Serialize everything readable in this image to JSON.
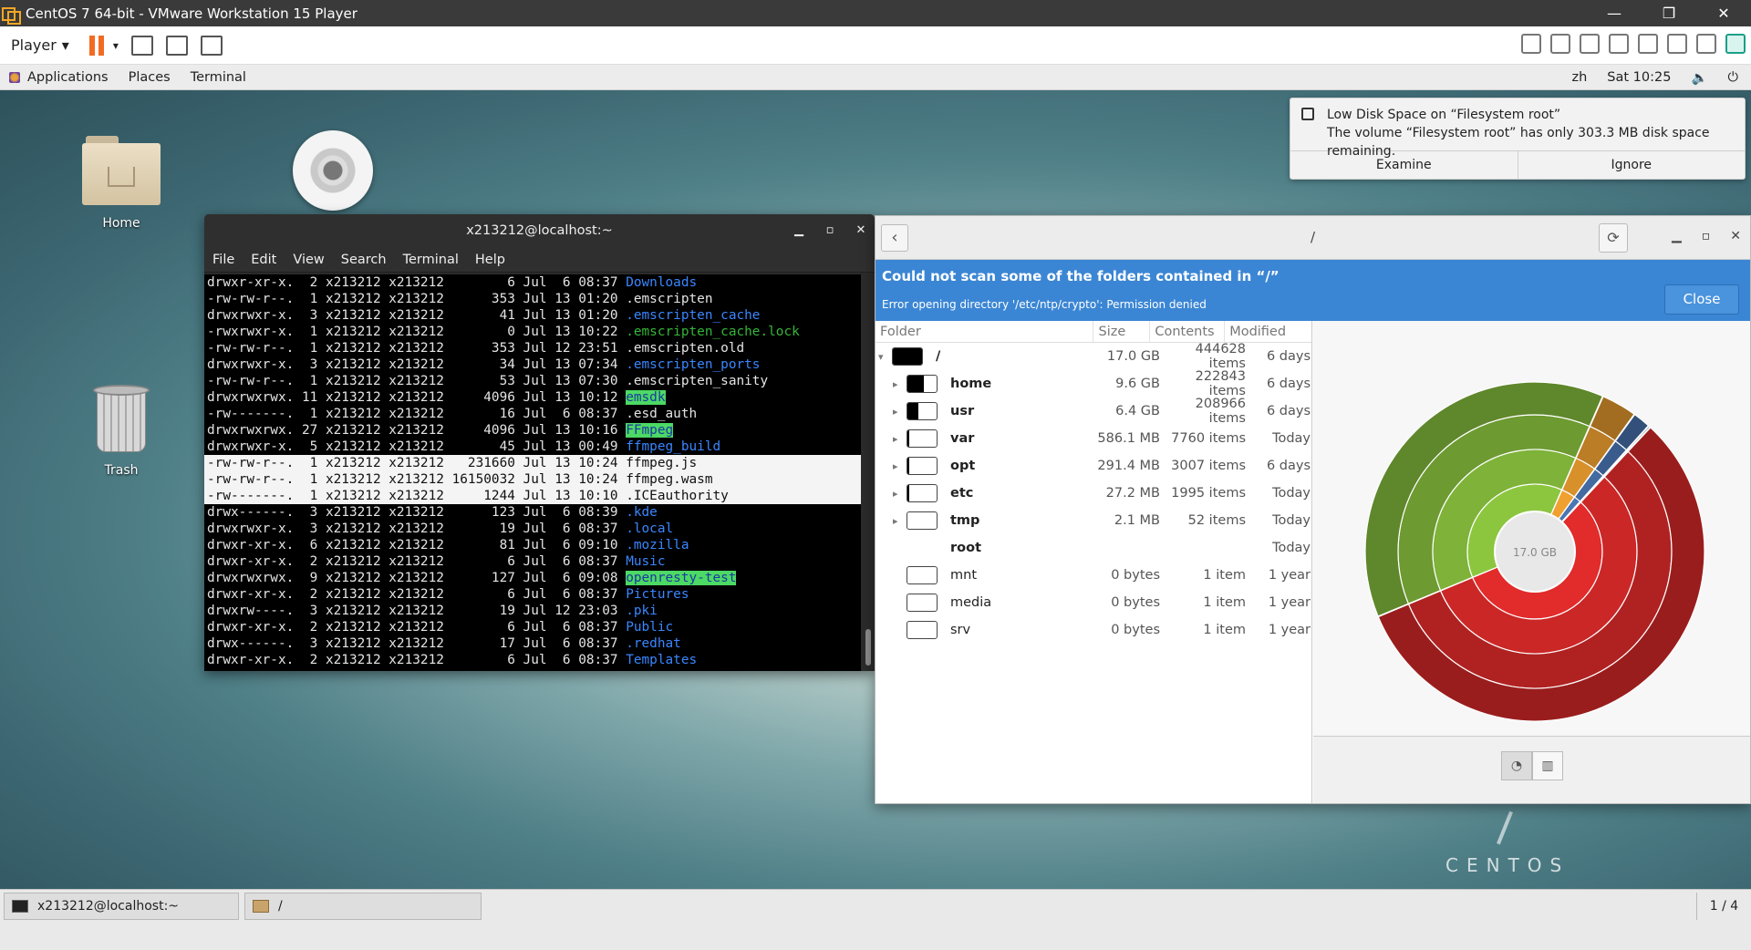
{
  "vm": {
    "title": "CentOS 7 64-bit - VMware Workstation 15 Player",
    "player_menu": "Player",
    "minimize": "—",
    "restore": "❐",
    "close": "✕"
  },
  "gnome": {
    "applications": "Applications",
    "places": "Places",
    "terminal": "Terminal",
    "input_method": "zh",
    "clock": "Sat 10:25"
  },
  "desktop": {
    "home_label": "Home",
    "trash_label": "Trash",
    "brand": "CENTOS"
  },
  "notification": {
    "title": "Low Disk Space on “Filesystem root”",
    "body": "The volume “Filesystem root” has only 303.3 MB disk space remaining.",
    "examine": "Examine",
    "ignore": "Ignore"
  },
  "terminal": {
    "title": "x213212@localhost:~",
    "menu": [
      "File",
      "Edit",
      "View",
      "Search",
      "Terminal",
      "Help"
    ],
    "lines": [
      {
        "meta": "drwxr-xr-x.  2 x213212 x213212        6 Jul  6 08:37 ",
        "name": "Downloads",
        "style": "blue"
      },
      {
        "meta": "-rw-rw-r--.  1 x213212 x213212      353 Jul 13 01:20 ",
        "name": ".emscripten",
        "style": ""
      },
      {
        "meta": "drwxrwxr-x.  3 x213212 x213212       41 Jul 13 01:20 ",
        "name": ".emscripten_cache",
        "style": "blue"
      },
      {
        "meta": "-rwxrwxr-x.  1 x213212 x213212        0 Jul 13 10:22 ",
        "name": ".emscripten_cache.lock",
        "style": "green"
      },
      {
        "meta": "-rw-rw-r--.  1 x213212 x213212      353 Jul 12 23:51 ",
        "name": ".emscripten.old",
        "style": ""
      },
      {
        "meta": "drwxrwxr-x.  3 x213212 x213212       34 Jul 13 07:34 ",
        "name": ".emscripten_ports",
        "style": "blue"
      },
      {
        "meta": "-rw-rw-r--.  1 x213212 x213212       53 Jul 13 07:30 ",
        "name": ".emscripten_sanity",
        "style": ""
      },
      {
        "meta": "drwxrwxrwx. 11 x213212 x213212     4096 Jul 13 10:12 ",
        "name": "emsdk",
        "style": "hl"
      },
      {
        "meta": "-rw-------.  1 x213212 x213212       16 Jul  6 08:37 ",
        "name": ".esd_auth",
        "style": ""
      },
      {
        "meta": "drwxrwxrwx. 27 x213212 x213212     4096 Jul 13 10:16 ",
        "name": "FFmpeg",
        "style": "hl"
      },
      {
        "meta": "drwxrwxr-x.  5 x213212 x213212       45 Jul 13 00:49 ",
        "name": "ffmpeg_build",
        "style": "blue"
      },
      {
        "meta": "-rw-rw-r--.  1 x213212 x213212   231660 Jul 13 10:24 ",
        "name": "ffmpeg.js",
        "style": "sel"
      },
      {
        "meta": "-rw-rw-r--.  1 x213212 x213212 16150032 Jul 13 10:24 ",
        "name": "ffmpeg.wasm",
        "style": "sel"
      },
      {
        "meta": "-rw-------.  1 x213212 x213212     1244 Jul 13 10:10 ",
        "name": ".ICEauthority",
        "style": "sel"
      },
      {
        "meta": "drwx------.  3 x213212 x213212      123 Jul  6 08:39 ",
        "name": ".kde",
        "style": "blue"
      },
      {
        "meta": "drwxrwxr-x.  3 x213212 x213212       19 Jul  6 08:37 ",
        "name": ".local",
        "style": "blue"
      },
      {
        "meta": "drwxr-xr-x.  6 x213212 x213212       81 Jul  6 09:10 ",
        "name": ".mozilla",
        "style": "blue"
      },
      {
        "meta": "drwxr-xr-x.  2 x213212 x213212        6 Jul  6 08:37 ",
        "name": "Music",
        "style": "blue"
      },
      {
        "meta": "drwxrwxrwx.  9 x213212 x213212      127 Jul  6 09:08 ",
        "name": "openresty-test",
        "style": "hl"
      },
      {
        "meta": "drwxr-xr-x.  2 x213212 x213212        6 Jul  6 08:37 ",
        "name": "Pictures",
        "style": "blue"
      },
      {
        "meta": "drwxrw----.  3 x213212 x213212       19 Jul 12 23:03 ",
        "name": ".pki",
        "style": "blue"
      },
      {
        "meta": "drwxr-xr-x.  2 x213212 x213212        6 Jul  6 08:37 ",
        "name": "Public",
        "style": "blue"
      },
      {
        "meta": "drwx------.  3 x213212 x213212       17 Jul  6 08:37 ",
        "name": ".redhat",
        "style": "blue"
      },
      {
        "meta": "drwxr-xr-x.  2 x213212 x213212        6 Jul  6 08:37 ",
        "name": "Templates",
        "style": "blue"
      }
    ]
  },
  "baobab": {
    "path": "/",
    "info_title": "Could not scan some of the folders contained in “/”",
    "info_detail": "Error opening directory '/etc/ntp/crypto': Permission denied",
    "close": "Close",
    "columns": [
      "Folder",
      "Size",
      "Contents",
      "Modified"
    ],
    "rows": [
      {
        "name": "/",
        "size": "17.0 GB",
        "contents": "444628 items",
        "modified": "6 days",
        "fill": 1.0,
        "depth": 0,
        "expander": "expanded",
        "bold": true
      },
      {
        "name": "home",
        "size": "9.6 GB",
        "contents": "222843 items",
        "modified": "6 days",
        "fill": 0.565,
        "depth": 1,
        "expander": "collapsed",
        "bold": true
      },
      {
        "name": "usr",
        "size": "6.4 GB",
        "contents": "208966 items",
        "modified": "6 days",
        "fill": 0.376,
        "depth": 1,
        "expander": "collapsed",
        "bold": true
      },
      {
        "name": "var",
        "size": "586.1 MB",
        "contents": "7760 items",
        "modified": "Today",
        "fill": 0.034,
        "depth": 1,
        "expander": "collapsed",
        "bold": true
      },
      {
        "name": "opt",
        "size": "291.4 MB",
        "contents": "3007 items",
        "modified": "6 days",
        "fill": 0.017,
        "depth": 1,
        "expander": "collapsed",
        "bold": true
      },
      {
        "name": "etc",
        "size": "27.2 MB",
        "contents": "1995 items",
        "modified": "Today",
        "fill": 0.002,
        "depth": 1,
        "expander": "collapsed",
        "bold": true
      },
      {
        "name": "tmp",
        "size": "2.1 MB",
        "contents": "52 items",
        "modified": "Today",
        "fill": 0.0,
        "depth": 1,
        "expander": "collapsed",
        "bold": true
      },
      {
        "name": "root",
        "size": "",
        "contents": "",
        "modified": "Today",
        "fill": null,
        "depth": 1,
        "expander": "none",
        "bold": true
      },
      {
        "name": "mnt",
        "size": "0 bytes",
        "contents": "1 item",
        "modified": "1 year",
        "fill": 0.0,
        "depth": 1,
        "expander": "none",
        "bold": false
      },
      {
        "name": "media",
        "size": "0 bytes",
        "contents": "1 item",
        "modified": "1 year",
        "fill": 0.0,
        "depth": 1,
        "expander": "none",
        "bold": false
      },
      {
        "name": "srv",
        "size": "0 bytes",
        "contents": "1 item",
        "modified": "1 year",
        "fill": 0.0,
        "depth": 1,
        "expander": "none",
        "bold": false
      }
    ],
    "center_label": "17.0 GB",
    "colors": {
      "home": "#e22b2b",
      "usr": "#8cc63f",
      "var": "#f0a030",
      "other": "#4a76b3"
    }
  },
  "taskbar": {
    "terminal_item": "x213212@localhost:~",
    "files_item": "/",
    "pager": "1 / 4"
  }
}
